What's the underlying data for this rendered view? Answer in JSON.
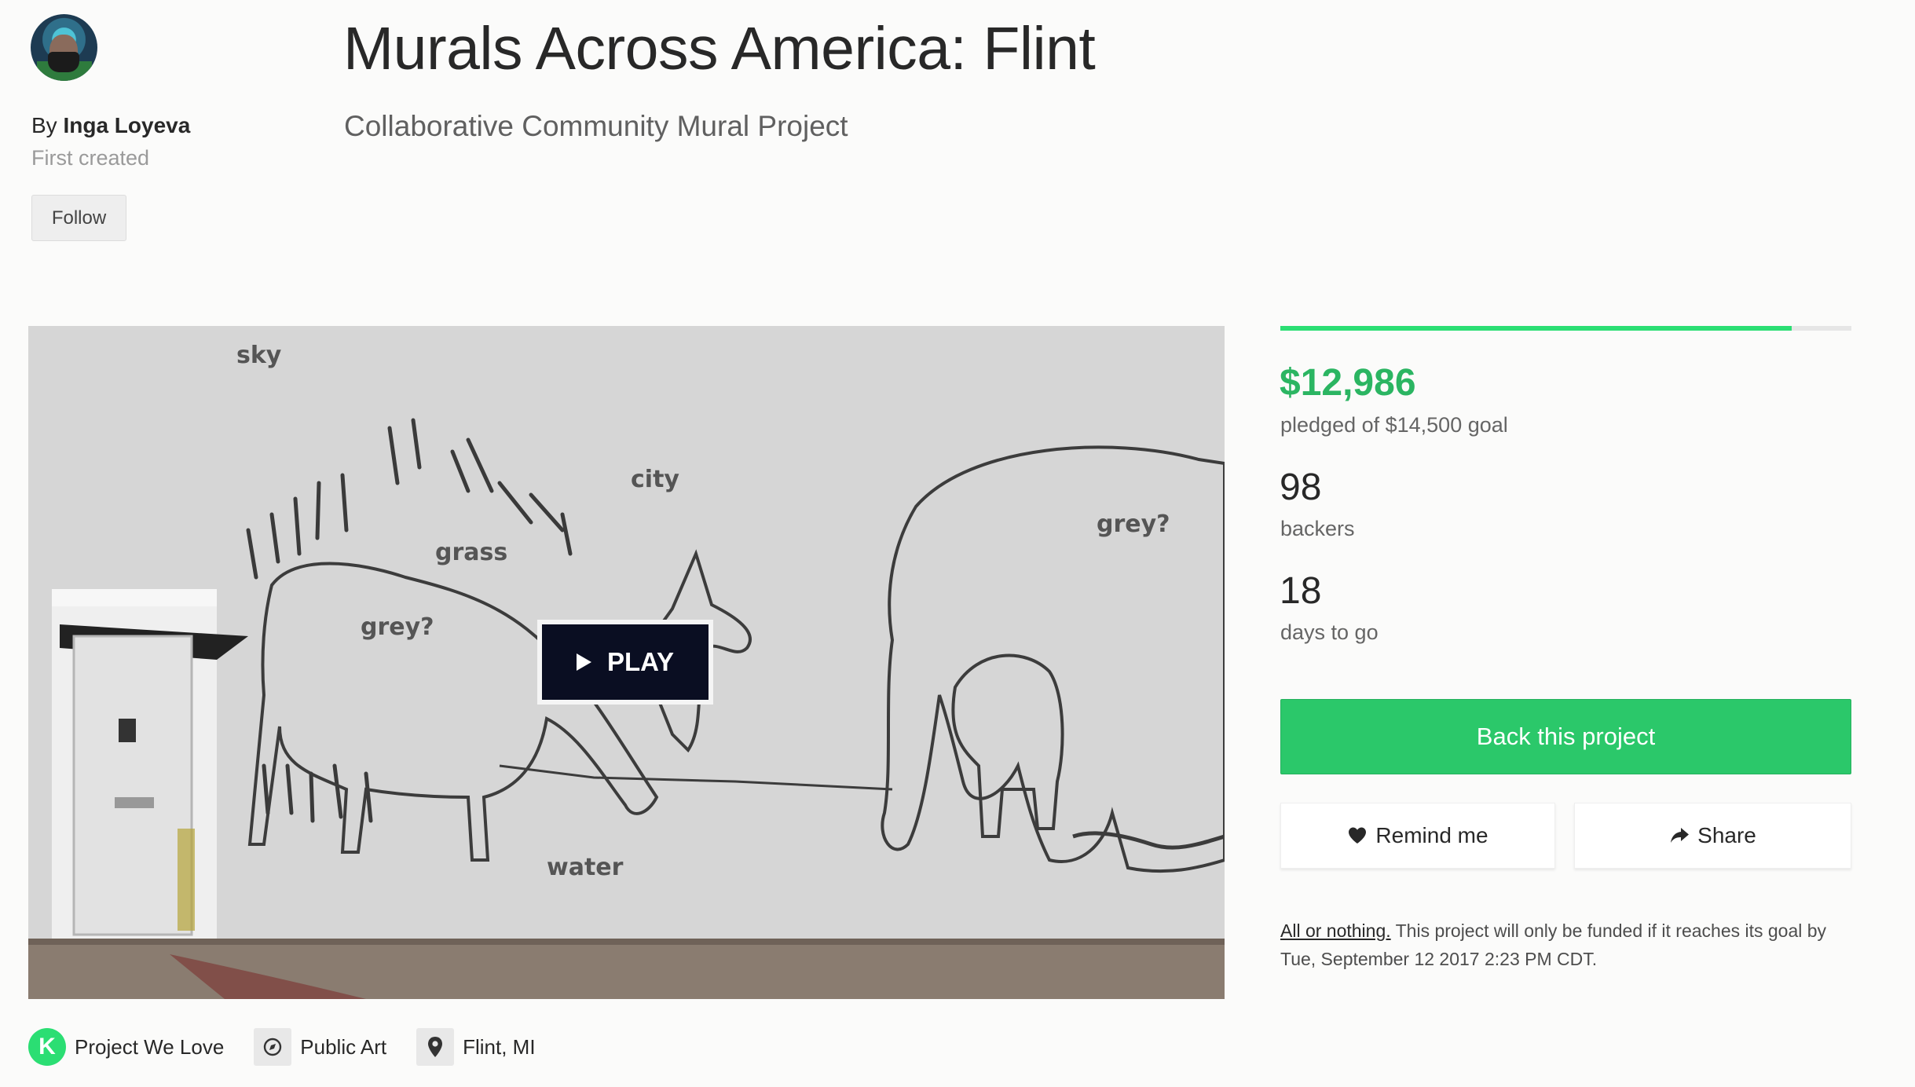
{
  "creator": {
    "by_prefix": "By",
    "name": "Inga Loyeva",
    "first_created": "First created",
    "follow_label": "Follow"
  },
  "project": {
    "title": "Murals Across America: Flint",
    "subtitle": "Collaborative Community Mural Project"
  },
  "video": {
    "play_label": "PLAY",
    "mural_words": {
      "sky": "sky",
      "city": "city",
      "grass": "grass",
      "grey_donkey": "grey?",
      "grey_elephant": "grey?",
      "water": "water"
    }
  },
  "tags": [
    {
      "label": "Project We Love",
      "icon": "kickstarter-k-icon"
    },
    {
      "label": "Public Art",
      "icon": "compass-icon"
    },
    {
      "label": "Flint, MI",
      "icon": "location-pin-icon"
    }
  ],
  "funding": {
    "progress_fraction": 0.896,
    "pledged": "$12,986",
    "pledged_goal_text": "pledged of $14,500 goal",
    "backers": "98",
    "backers_label": "backers",
    "days": "18",
    "days_label": "days to go"
  },
  "actions": {
    "back_label": "Back this project",
    "remind_label": "Remind me",
    "share_label": "Share"
  },
  "fine_print": {
    "all_or_nothing": "All or nothing.",
    "text": " This project will only be funded if it reaches its goal by Tue, September 12 2017 2:23 PM CDT."
  },
  "colors": {
    "accent_green": "#2bde73",
    "pledged_green": "#2bb562",
    "button_green": "#2bc86a",
    "play_button": "#0a0e22"
  }
}
